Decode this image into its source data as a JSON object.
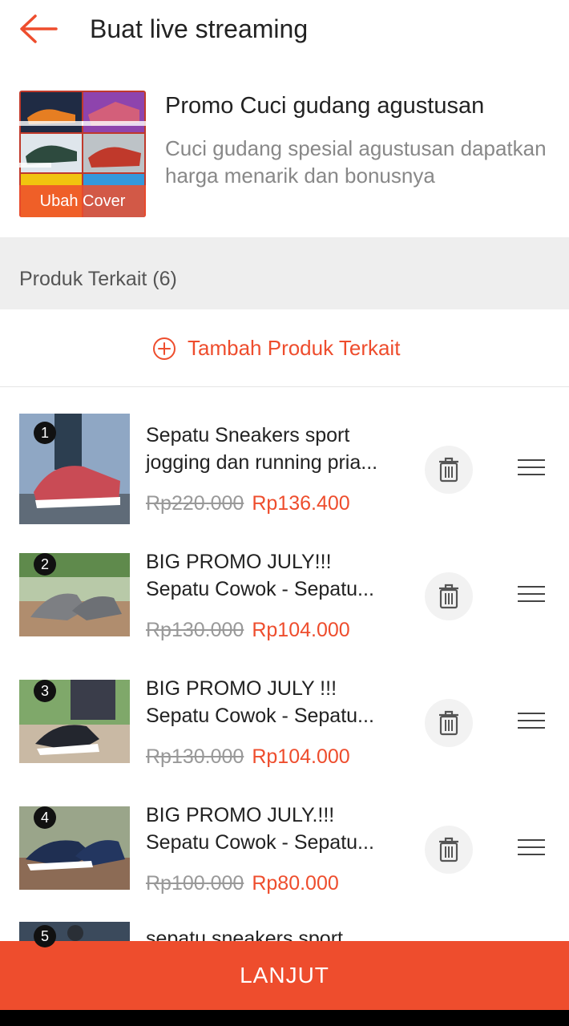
{
  "header": {
    "title": "Buat live streaming",
    "back_icon": "arrow-left-icon",
    "accent": "#ee4d2d"
  },
  "stream": {
    "title": "Promo Cuci gudang agustusan",
    "description": "Cuci gudang spesial agustusan dapatkan harga menarik dan bonusnya",
    "cover_label": "Ubah Cover"
  },
  "related": {
    "section_title": "Produk Terkait (6)",
    "add_label": "Tambah Produk Terkait",
    "add_icon": "plus-circle-icon"
  },
  "products": [
    {
      "num": "1",
      "name_line1": "Sepatu Sneakers sport",
      "name_line2": "jogging dan running pria...",
      "old_price": "Rp220.000",
      "new_price": "Rp136.400"
    },
    {
      "num": "2",
      "name_line1": "BIG PROMO JULY!!!",
      "name_line2": "Sepatu Cowok - Sepatu...",
      "old_price": "Rp130.000",
      "new_price": "Rp104.000"
    },
    {
      "num": "3",
      "name_line1": "BIG PROMO JULY !!!",
      "name_line2": "Sepatu Cowok - Sepatu...",
      "old_price": "Rp130.000",
      "new_price": "Rp104.000"
    },
    {
      "num": "4",
      "name_line1": "BIG PROMO JULY.!!!",
      "name_line2": "Sepatu Cowok - Sepatu...",
      "old_price": "Rp100.000",
      "new_price": "Rp80.000"
    },
    {
      "num": "5",
      "name_line1": "sepatu sneakers sport"
    }
  ],
  "footer": {
    "button_label": "LANJUT"
  }
}
